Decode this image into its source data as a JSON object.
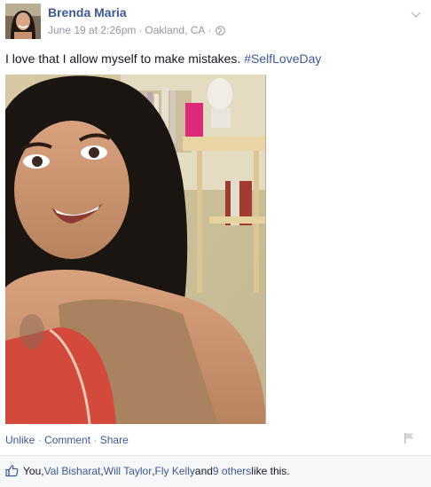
{
  "post": {
    "author": "Brenda Maria",
    "date": "June 19 at 2:26pm",
    "separator1": " · ",
    "location": "Oakland, CA",
    "separator2": " · ",
    "text_prefix": "I love that I allow myself to make mistakes. ",
    "hashtag": "#SelfLoveDay",
    "icons": {
      "privacy": "globe-icon",
      "menu": "chevron-down-icon",
      "report": "flag-icon",
      "like": "thumbs-up-icon"
    }
  },
  "actions": {
    "unlike": "Unlike",
    "sep1": " · ",
    "comment": "Comment",
    "sep2": " · ",
    "share": "Share"
  },
  "likes": {
    "you": "You, ",
    "person1": "Val Bisharat",
    "comma1": ", ",
    "person2": "Will Taylor",
    "comma2": ", ",
    "person3": "Fly Kelly",
    "and": " and ",
    "others": "9 others",
    "suffix": " like this."
  },
  "colors": {
    "link": "#3b5998",
    "meta": "#9197a3",
    "text": "#141823",
    "likes_bg": "#f6f7f9"
  }
}
